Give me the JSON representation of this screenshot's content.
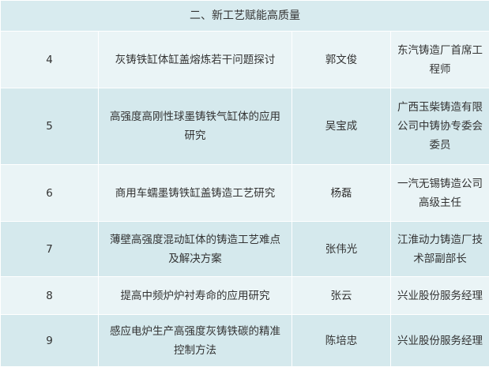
{
  "section": {
    "title": "二、新工艺赋能高质量"
  },
  "rows": [
    {
      "no": "4",
      "title": "灰铸铁缸体缸盖熔炼若干问题探讨",
      "speaker": "郭文俊",
      "org": "东汽铸造厂首席工程师"
    },
    {
      "no": "5",
      "title": "高强度高刚性球墨铸铁气缸体的应用研究",
      "speaker": "吴宝成",
      "org": "广西玉柴铸造有限公司中铸协专委会委员"
    },
    {
      "no": "6",
      "title": "商用车蠕墨铸铁缸盖铸造工艺研究",
      "speaker": "杨磊",
      "org": "一汽无锡铸造公司高级主任"
    },
    {
      "no": "7",
      "title": "薄壁高强度混动缸体的铸造工艺难点及解决方案",
      "speaker": "张伟光",
      "org": "江淮动力铸造厂技术部副部长"
    },
    {
      "no": "8",
      "title": "提高中频炉炉衬寿命的应用研究",
      "speaker": "张云",
      "org": "兴业股份服务经理"
    },
    {
      "no": "9",
      "title": "感应电炉生产高强度灰铸铁碳的精准控制方法",
      "speaker": "陈培忠",
      "org": "兴业股份服务经理"
    }
  ]
}
